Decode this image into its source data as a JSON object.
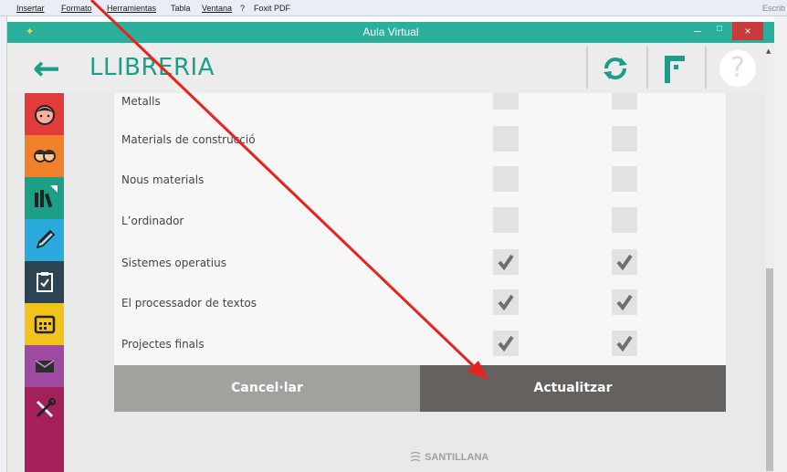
{
  "word_menu": [
    "Insertar",
    "Formato",
    "Herramientas",
    "Tabla",
    "Ventana",
    "?",
    "Foxit PDF"
  ],
  "word_right_text": "Escrib",
  "window": {
    "title": "Aula Virtual",
    "min": "–",
    "max": "□",
    "close": "×"
  },
  "header": {
    "back": "←",
    "page_title": "LLIBRERIA",
    "help": "?"
  },
  "sidebar": [
    {
      "icon": "face-icon",
      "color": "#e23b3b"
    },
    {
      "icon": "group-icon",
      "color": "#f0812a"
    },
    {
      "icon": "books-icon",
      "color": "#1d9f86"
    },
    {
      "icon": "pencil-icon",
      "color": "#2aa9dd"
    },
    {
      "icon": "clipboard-icon",
      "color": "#2d4454"
    },
    {
      "icon": "calendar-icon",
      "color": "#f2c31a"
    },
    {
      "icon": "mail-icon",
      "color": "#9e4aa0"
    },
    {
      "icon": "tools-icon",
      "color": "#a3205a"
    }
  ],
  "rows": [
    {
      "label": "Metalls",
      "col1": false,
      "col2": false
    },
    {
      "label": "Materials de construcció",
      "col1": false,
      "col2": false
    },
    {
      "label": "Nous materials",
      "col1": false,
      "col2": false
    },
    {
      "label": "L’ordinador",
      "col1": false,
      "col2": false
    },
    {
      "label": "Sistemes operatius",
      "col1": true,
      "col2": true
    },
    {
      "label": "El processador de textos",
      "col1": true,
      "col2": true
    },
    {
      "label": "Projectes finals",
      "col1": true,
      "col2": true
    }
  ],
  "buttons": {
    "cancel": "Cancel·lar",
    "update": "Actualitzar"
  },
  "footer": "SANTILLANA",
  "colors": {
    "accent": "#2ab09a",
    "annotation_arrow": "#e8231b"
  }
}
